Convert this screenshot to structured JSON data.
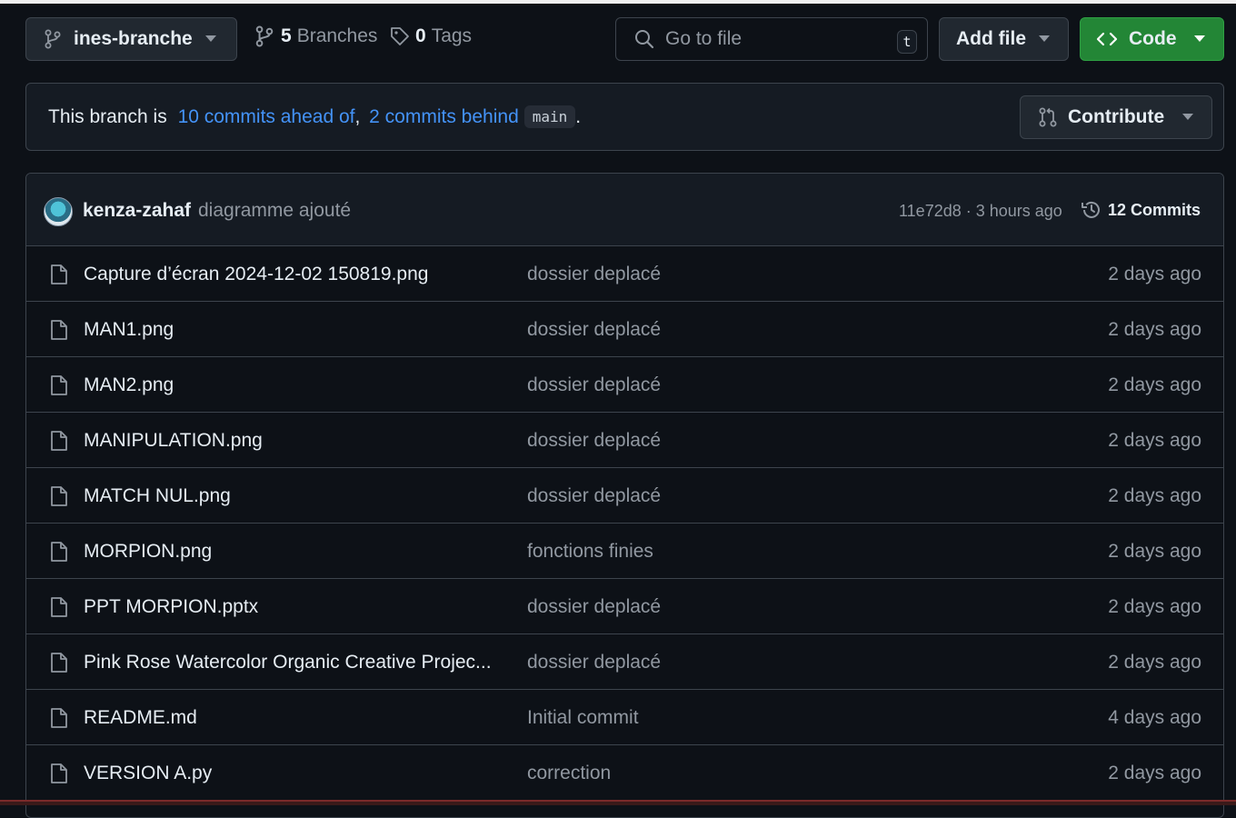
{
  "toolbar": {
    "branch_name": "ines-branche",
    "branches_count": "5",
    "branches_label": "Branches",
    "tags_count": "0",
    "tags_label": "Tags",
    "search_placeholder": "Go to file",
    "search_shortcut": "t",
    "add_file_label": "Add file",
    "code_label": "Code"
  },
  "status": {
    "prefix": "This branch is ",
    "ahead": "10 commits ahead of",
    "separator": ", ",
    "behind": "2 commits behind",
    "base_branch": "main",
    "suffix": ".",
    "contribute_label": "Contribute"
  },
  "latest_commit": {
    "author": "kenza-zahaf",
    "message": "diagramme ajouté",
    "info": "11e72d8 · 3 hours ago",
    "commits_label": "12 Commits"
  },
  "files": [
    {
      "name": "Capture d’écran 2024-12-02 150819.png",
      "message": "dossier deplacé",
      "date": "2 days ago"
    },
    {
      "name": "MAN1.png",
      "message": "dossier deplacé",
      "date": "2 days ago"
    },
    {
      "name": "MAN2.png",
      "message": "dossier deplacé",
      "date": "2 days ago"
    },
    {
      "name": "MANIPULATION.png",
      "message": "dossier deplacé",
      "date": "2 days ago"
    },
    {
      "name": "MATCH NUL.png",
      "message": "dossier deplacé",
      "date": "2 days ago"
    },
    {
      "name": "MORPION.png",
      "message": "fonctions finies",
      "date": "2 days ago"
    },
    {
      "name": "PPT MORPION.pptx",
      "message": "dossier deplacé",
      "date": "2 days ago"
    },
    {
      "name": "Pink Rose Watercolor Organic Creative Projec...",
      "message": "dossier deplacé",
      "date": "2 days ago"
    },
    {
      "name": "README.md",
      "message": "Initial commit",
      "date": "4 days ago"
    },
    {
      "name": "VERSION A.py",
      "message": "correction",
      "date": "2 days ago"
    }
  ],
  "colors": {
    "background": "#0d1117",
    "accent_link": "#4493f8",
    "code_button": "#238636"
  }
}
